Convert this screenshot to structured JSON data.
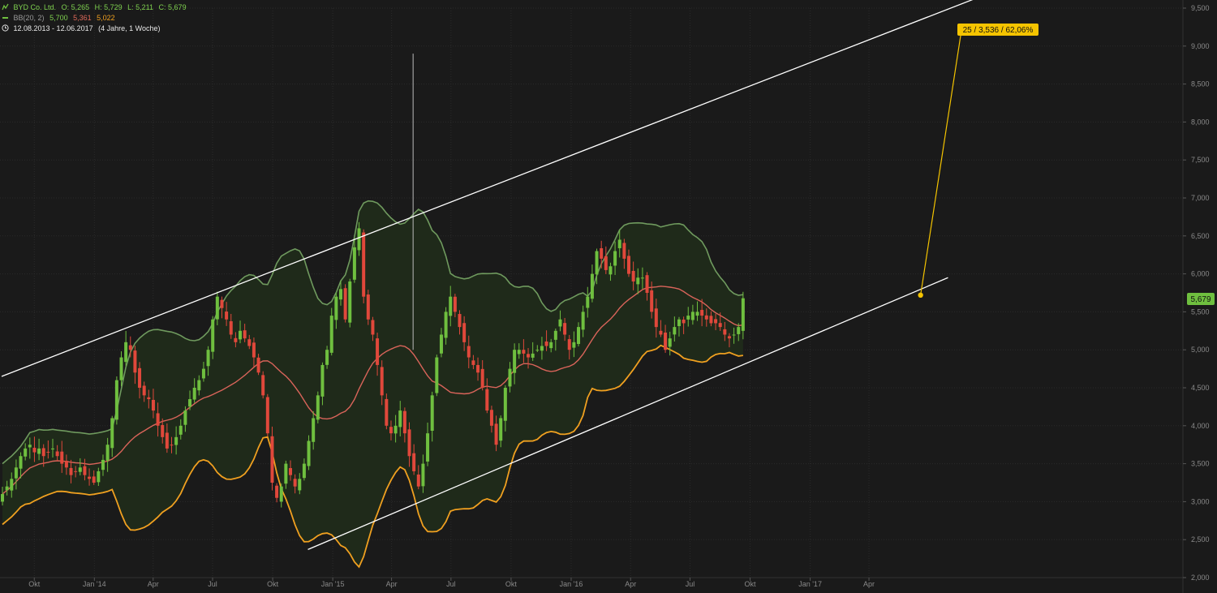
{
  "header": {
    "line1": {
      "name": "BYD Co. Ltd.",
      "o": "O: 5,265",
      "h": "H: 5,729",
      "l": "L: 5,211",
      "c": "C: 5,679"
    },
    "line2": {
      "name": "BB(20, 2)",
      "v1": "5,700",
      "v2": "5,361",
      "v3": "5,022"
    },
    "line3": {
      "range": "12.08.2013 - 12.06.2017",
      "span": "(4 Jahre, 1 Woche)"
    }
  },
  "annotation": {
    "label": "25 / 3,536 / 62,06%"
  },
  "price_badge": "5,679",
  "colors": {
    "up": "#6fbf3f",
    "down": "#e0483b",
    "bb_mid": "#d9645a",
    "bb_upper": "#6f9a5e",
    "bb_lower": "#f0a020",
    "band_fill": "#1f2a1a",
    "trend": "#ffffff",
    "annotation": "#f5c400"
  },
  "chart_data": {
    "type": "candlestick",
    "title": "BYD Co. Ltd.",
    "x_ticks": [
      "Okt",
      "Jan '14",
      "Apr",
      "Jul",
      "Okt",
      "Jan '15",
      "Apr",
      "Jul",
      "Okt",
      "Jan '16",
      "Apr",
      "Jul",
      "Okt",
      "Jan '17",
      "Apr"
    ],
    "y_ticks": [
      "9,500",
      "9,000",
      "8,500",
      "8,000",
      "7,500",
      "7,000",
      "6,500",
      "6,000",
      "5,500",
      "5,000",
      "4,500",
      "4,000",
      "3,500",
      "3,000",
      "2,500",
      "2,000"
    ],
    "ylim": [
      2.0,
      9.5
    ],
    "frequency": "weekly",
    "x_range": [
      "2013-08-12",
      "2017-06-12"
    ],
    "closes": [
      3.1,
      3.2,
      3.3,
      3.45,
      3.6,
      3.7,
      3.75,
      3.65,
      3.7,
      3.6,
      3.65,
      3.7,
      3.6,
      3.5,
      3.45,
      3.35,
      3.4,
      3.45,
      3.35,
      3.3,
      3.25,
      3.4,
      3.55,
      3.75,
      4.1,
      4.6,
      4.9,
      5.1,
      5.0,
      4.7,
      4.5,
      4.4,
      4.35,
      4.2,
      4.0,
      3.85,
      3.7,
      3.75,
      3.85,
      4.0,
      4.2,
      4.35,
      4.5,
      4.6,
      4.75,
      5.0,
      5.4,
      5.7,
      5.55,
      5.4,
      5.2,
      5.1,
      5.25,
      5.15,
      5.05,
      4.9,
      4.7,
      4.4,
      3.9,
      3.25,
      3.05,
      3.2,
      3.5,
      3.35,
      3.2,
      3.3,
      3.5,
      3.8,
      4.1,
      4.4,
      4.8,
      5.0,
      5.45,
      5.7,
      5.8,
      5.4,
      5.9,
      6.35,
      6.6,
      5.7,
      5.4,
      5.2,
      4.8,
      4.4,
      4.0,
      3.9,
      4.0,
      4.2,
      3.9,
      3.6,
      3.4,
      3.2,
      3.5,
      3.9,
      4.4,
      4.9,
      5.2,
      5.5,
      5.7,
      5.5,
      5.3,
      5.1,
      4.9,
      4.8,
      4.7,
      4.5,
      4.2,
      4.0,
      3.75,
      4.1,
      4.5,
      4.75,
      5.0,
      5.0,
      4.95,
      4.9,
      4.95,
      5.0,
      5.05,
      5.05,
      5.1,
      5.25,
      5.4,
      5.2,
      5.0,
      5.1,
      5.3,
      5.5,
      5.7,
      6.0,
      6.3,
      6.2,
      6.05,
      6.1,
      6.3,
      6.45,
      6.2,
      6.0,
      5.9,
      5.95,
      5.95,
      5.75,
      5.5,
      5.3,
      5.2,
      5.0,
      5.15,
      5.3,
      5.4,
      5.35,
      5.45,
      5.5,
      5.5,
      5.45,
      5.4,
      5.35,
      5.35,
      5.3,
      5.2,
      5.15,
      5.2,
      5.3,
      5.679
    ],
    "bollinger": {
      "period": 20,
      "stddev": 2,
      "upper": 5.7,
      "middle": 5.361,
      "lower": 5.022
    },
    "trendlines": [
      {
        "from": [
          "2013-08-12",
          4.65
        ],
        "to": [
          "2017-09-18",
          9.65
        ]
      },
      {
        "from": [
          "2014-11-24",
          2.37
        ],
        "to": [
          "2017-07-31",
          5.95
        ]
      }
    ],
    "projection": {
      "label": "25 / 3,536 / 62,06%",
      "from": [
        "2017-06-19",
        5.72
      ],
      "to": [
        "2017-08-21",
        9.23
      ]
    }
  }
}
